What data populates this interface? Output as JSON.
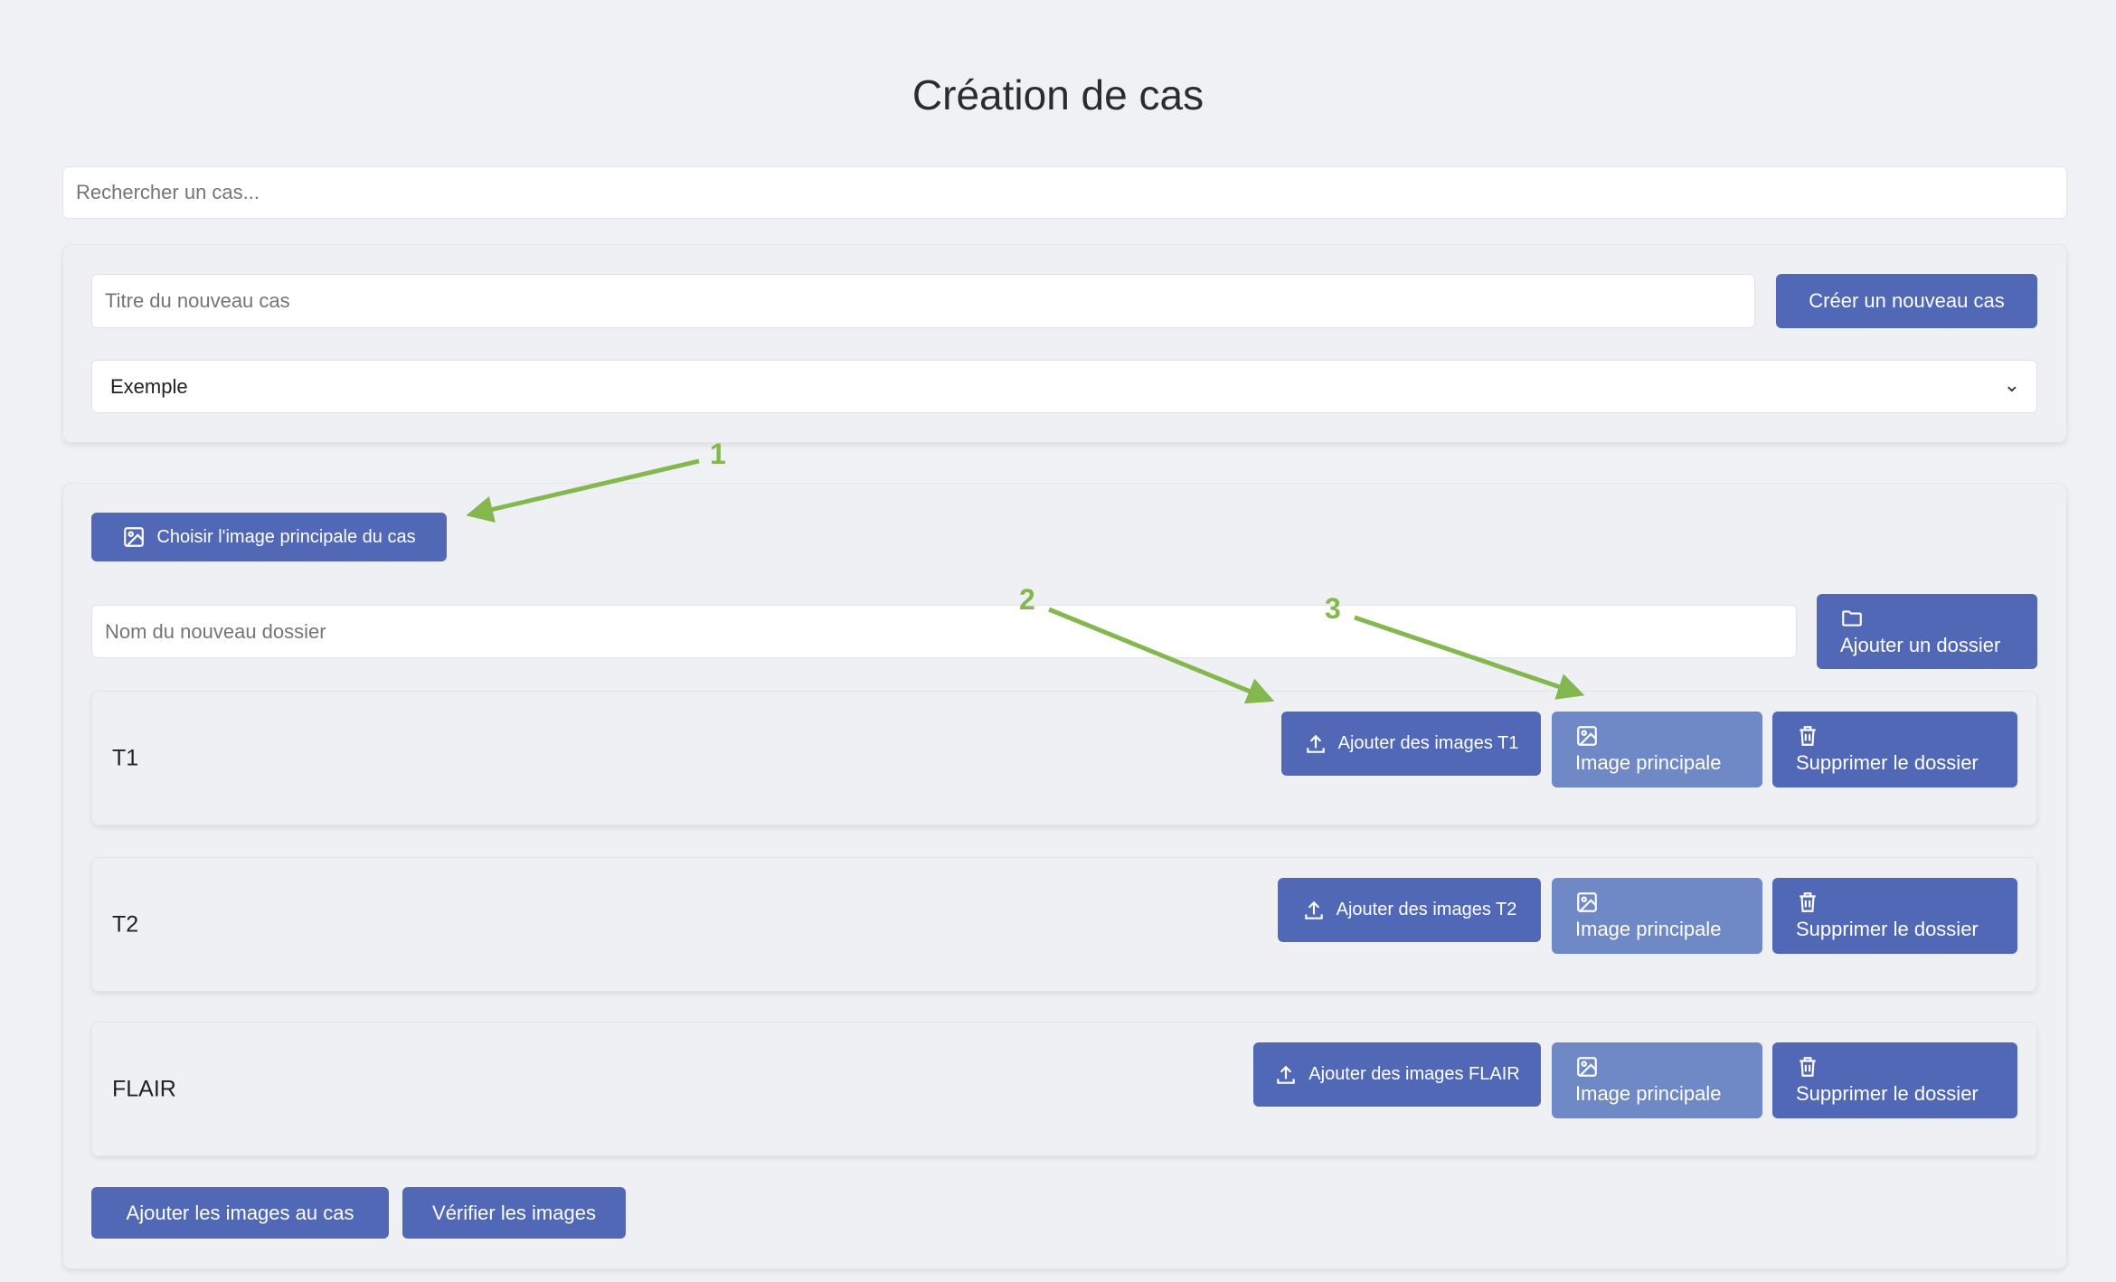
{
  "page_title": "Création de cas",
  "search": {
    "placeholder": "Rechercher un cas..."
  },
  "new_case": {
    "title_placeholder": "Titre du nouveau cas",
    "create_button": "Créer un nouveau cas",
    "select_value": "Exemple"
  },
  "case_editor": {
    "choose_main_image_button": "Choisir l'image principale du cas",
    "folder_name_placeholder": "Nom du nouveau dossier",
    "add_folder_button": "Ajouter un dossier",
    "folders": [
      {
        "name": "T1",
        "upload_label": "Ajouter des images T1",
        "main_image_label": "Image principale",
        "delete_label": "Supprimer le dossier"
      },
      {
        "name": "T2",
        "upload_label": "Ajouter des images T2",
        "main_image_label": "Image principale",
        "delete_label": "Supprimer le dossier"
      },
      {
        "name": "FLAIR",
        "upload_label": "Ajouter des images FLAIR",
        "main_image_label": "Image principale",
        "delete_label": "Supprimer le dossier"
      }
    ],
    "add_images_button": "Ajouter les images au cas",
    "verify_images_button": "Vérifier les images"
  },
  "annotations": [
    "1",
    "2",
    "3"
  ],
  "colors": {
    "primary": "#5068b5",
    "primary_light": "#6f88c6",
    "annotation": "#84b84e",
    "background": "#f0f1f5"
  }
}
